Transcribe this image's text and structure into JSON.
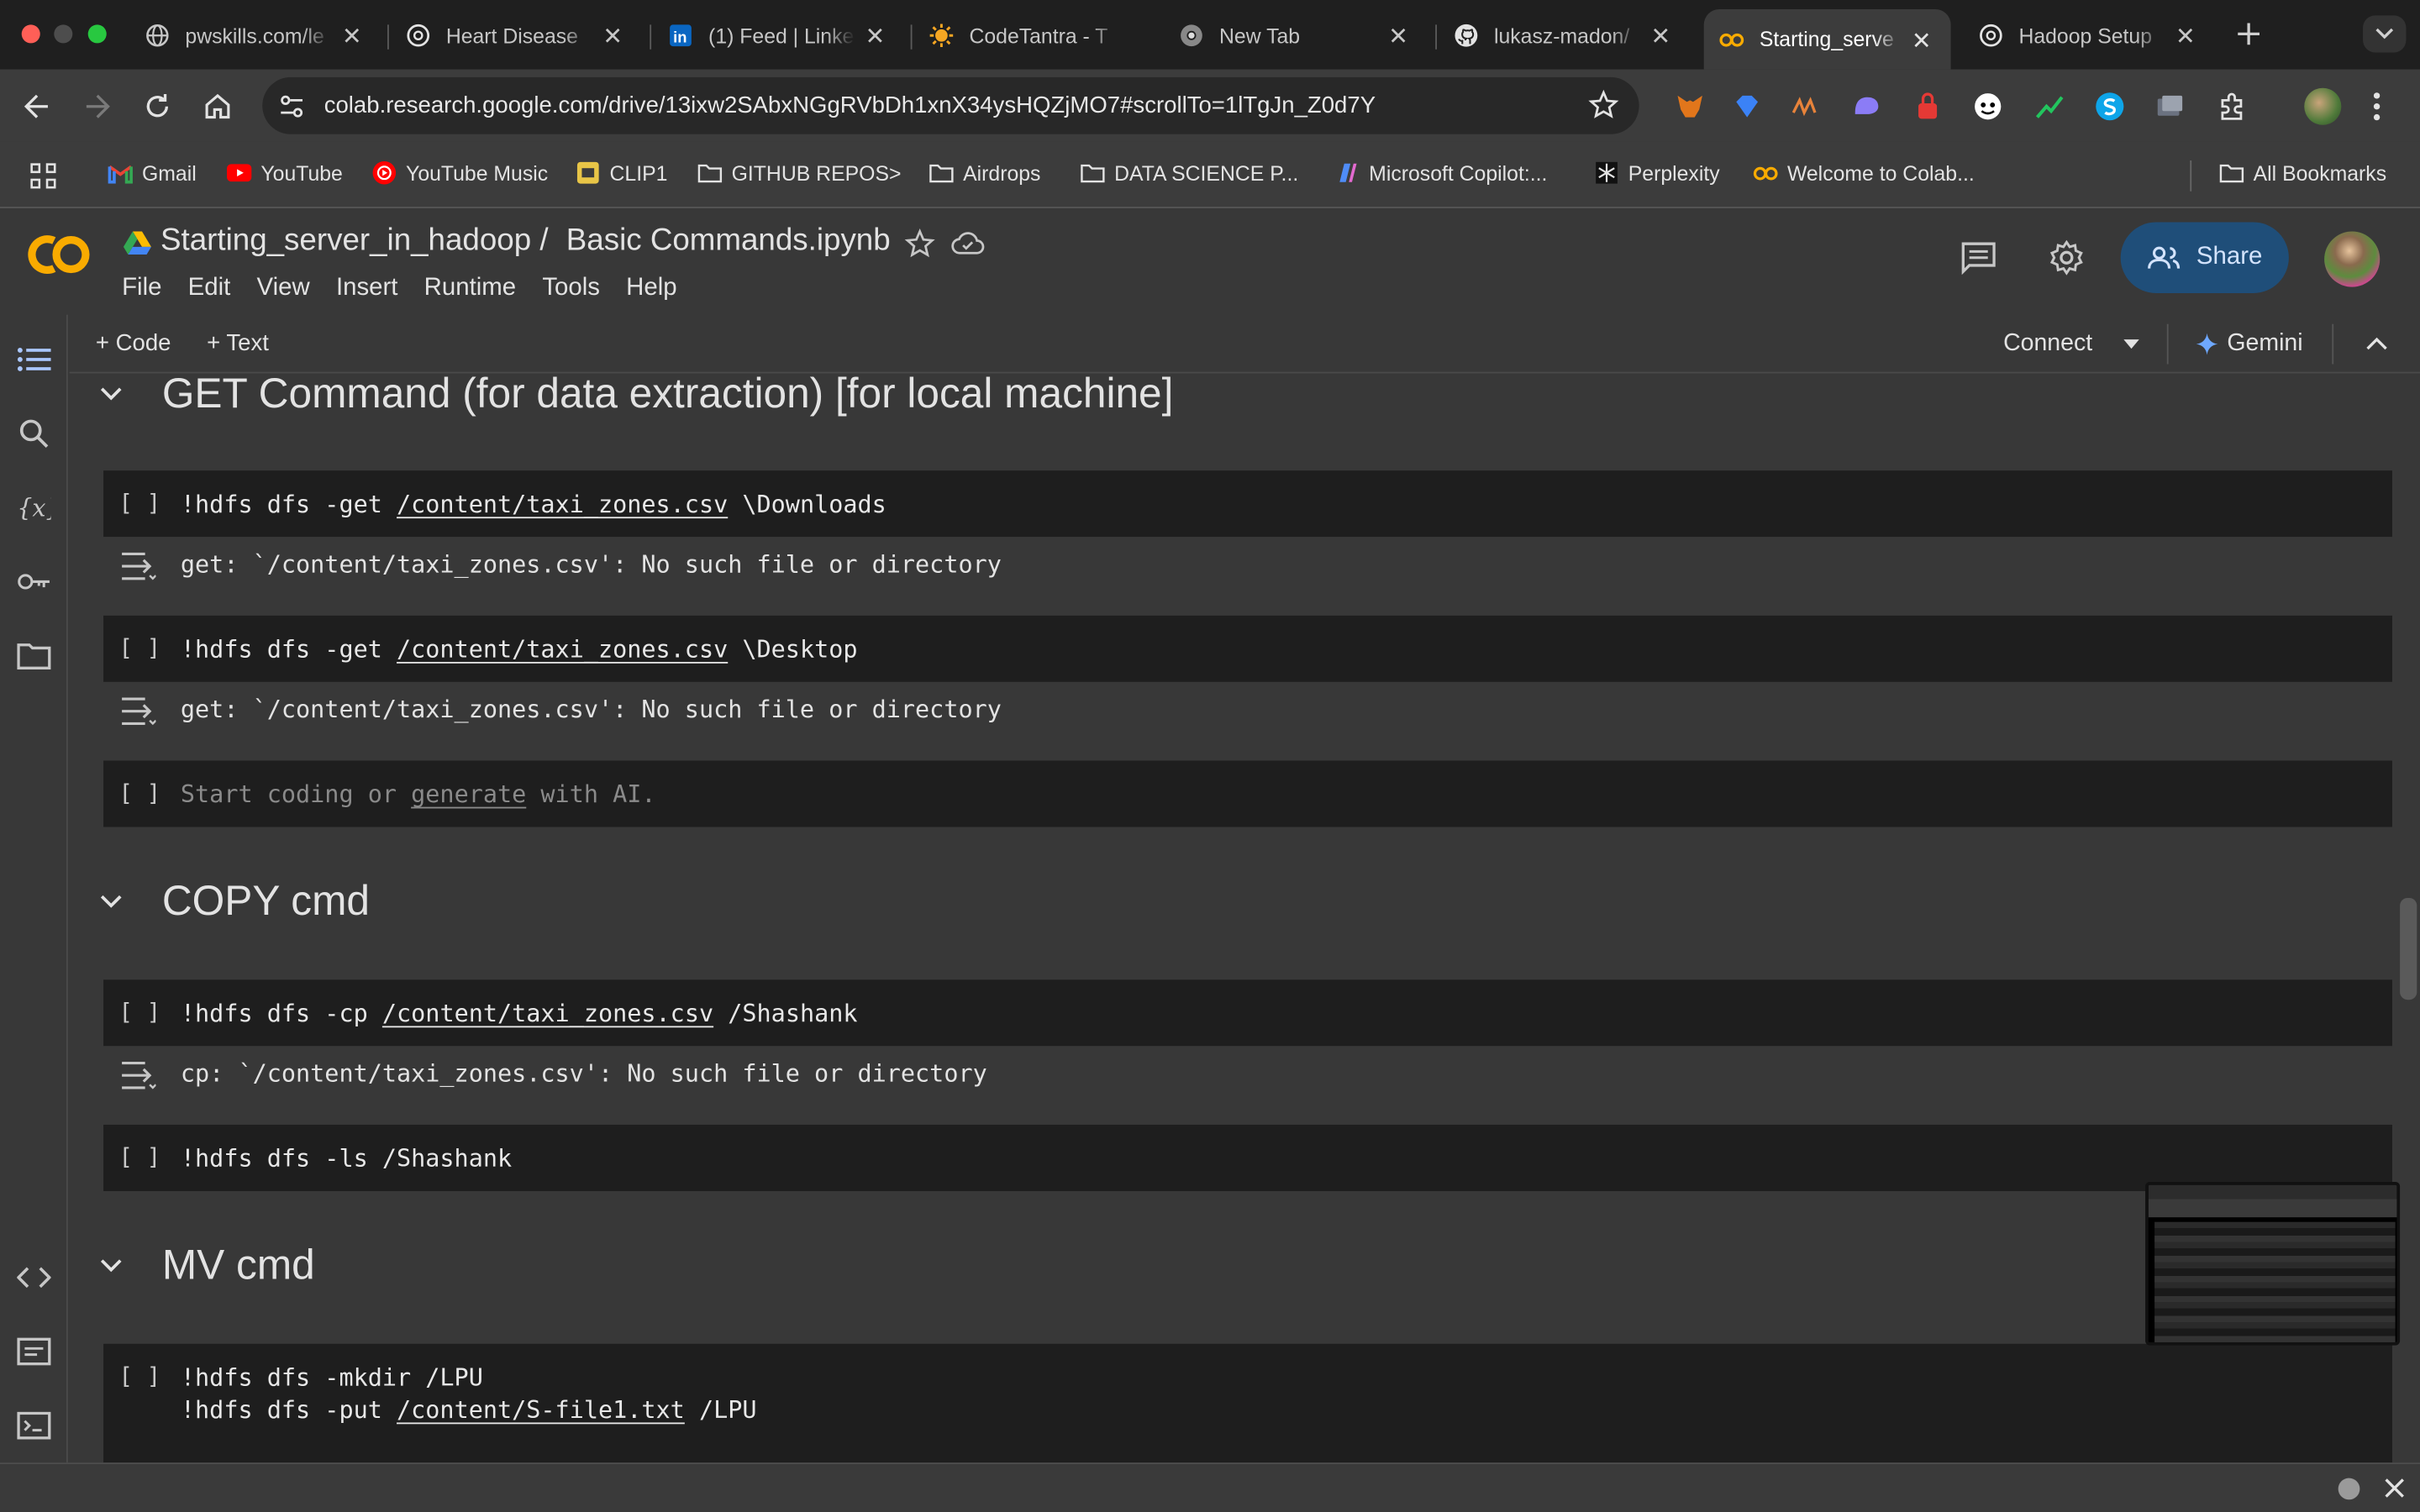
{
  "browser": {
    "tabs": [
      {
        "title": "pwskills.com/le",
        "icon": "globe-icon"
      },
      {
        "title": "Heart Disease",
        "icon": "chatgpt-icon"
      },
      {
        "title": "(1) Feed | Linke",
        "icon": "linkedin-icon"
      },
      {
        "title": "CodeTantra - T",
        "icon": "codetantra-icon"
      },
      {
        "title": "New Tab",
        "icon": "chrome-icon"
      },
      {
        "title": "lukasz-madon/",
        "icon": "github-icon"
      },
      {
        "title": "Starting_serve",
        "icon": "colab-icon"
      },
      {
        "title": "Hadoop Setup",
        "icon": "chatgpt-icon"
      }
    ],
    "url": "colab.research.google.com/drive/13ixw2SAbxNGgRVbDh1xnX34ysHQZjMO7#scrollTo=1lTgJn_Z0d7Y",
    "bookmarks": [
      {
        "label": "Gmail",
        "icon": "gmail-icon"
      },
      {
        "label": "YouTube",
        "icon": "youtube-icon"
      },
      {
        "label": "YouTube Music",
        "icon": "youtube-music-icon"
      },
      {
        "label": "CLIP1",
        "icon": "bookmark-image-icon"
      },
      {
        "label": "GITHUB REPOS>",
        "icon": "folder-icon"
      },
      {
        "label": "Airdrops",
        "icon": "folder-icon"
      },
      {
        "label": "DATA SCIENCE P...",
        "icon": "folder-icon"
      },
      {
        "label": "Microsoft Copilot:...",
        "icon": "copilot-icon"
      },
      {
        "label": "Perplexity",
        "icon": "perplexity-icon"
      },
      {
        "label": "Welcome to Colab...",
        "icon": "colab-icon"
      }
    ],
    "all_bookmarks": "All Bookmarks"
  },
  "colab": {
    "folder": "Starting_server_in_hadoop /",
    "filename": "Basic Commands.ipynb",
    "menus": [
      "File",
      "Edit",
      "View",
      "Insert",
      "Runtime",
      "Tools",
      "Help"
    ],
    "share_label": "Share",
    "add_code": "+ Code",
    "add_text": "+ Text",
    "connect": "Connect",
    "gemini": "Gemini"
  },
  "notebook": {
    "sections": [
      {
        "title": "GET Command (for data extraction) [for local machine]"
      },
      {
        "title": "COPY cmd"
      },
      {
        "title": "MV cmd"
      }
    ],
    "run_marker": "[ ]",
    "cells": [
      {
        "pre": "!hdfs dfs -get ",
        "path": "/content/taxi_zones.csv",
        "post": " \\Downloads",
        "output": "get: `/content/taxi_zones.csv': No such file or directory"
      },
      {
        "pre": "!hdfs dfs -get ",
        "path": "/content/taxi_zones.csv",
        "post": " \\Desktop",
        "output": "get: `/content/taxi_zones.csv': No such file or directory"
      },
      {
        "placeholder_pre": "Start coding or ",
        "placeholder_link": "generate",
        "placeholder_post": " with AI."
      },
      {
        "pre": "!hdfs dfs -cp ",
        "path": "/content/taxi_zones.csv",
        "post": " /Shashank",
        "output": "cp: `/content/taxi_zones.csv': No such file or directory"
      },
      {
        "pre": "!hdfs dfs -ls /Shashank"
      },
      {
        "line1": "!hdfs dfs -mkdir /LPU",
        "pre": "!hdfs dfs -put ",
        "path": "/content/S-file1.txt",
        "post": " /LPU"
      }
    ]
  },
  "colors": {
    "share_bg": "#1f4e79",
    "colab_orange": "#f9ab00",
    "cell_bg": "#1e1e1e"
  }
}
